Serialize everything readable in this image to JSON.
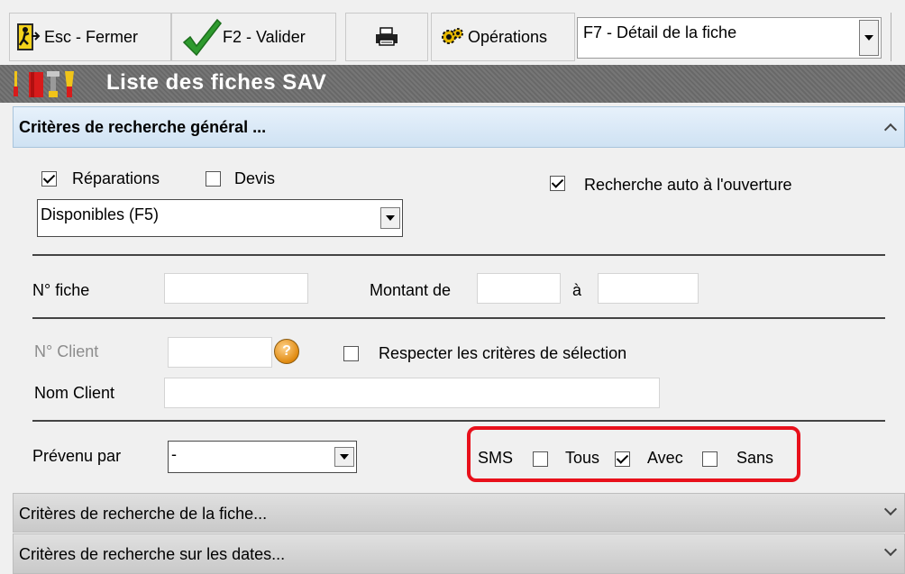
{
  "toolbar": {
    "close_label": "Esc - Fermer",
    "validate_label": "F2 - Valider",
    "operations_label": "Opérations",
    "operations_select_value": "F7 - Détail de la fiche"
  },
  "title": "Liste des fiches SAV",
  "general_panel": {
    "header": "Critères de recherche général ...",
    "repairs_label": "Réparations",
    "repairs_checked": true,
    "quotes_label": "Devis",
    "quotes_checked": false,
    "auto_search_label": "Recherche auto à l'ouverture",
    "auto_search_checked": true,
    "availability_value": "Disponibles (F5)",
    "ticket_no_label": "N° fiche",
    "ticket_no_value": "",
    "amount_from_label": "Montant de",
    "amount_from_value": "",
    "amount_to_label": "à",
    "amount_to_value": "",
    "client_no_label": "N° Client",
    "client_no_value": "",
    "respect_criteria_label": "Respecter les critères de sélection",
    "respect_criteria_checked": false,
    "client_name_label": "Nom Client",
    "client_name_value": "",
    "notified_by_label": "Prévenu par",
    "notified_by_value": "-",
    "sms": {
      "label": "SMS",
      "all_label": "Tous",
      "all_checked": false,
      "with_label": "Avec",
      "with_checked": true,
      "without_label": "Sans",
      "without_checked": false
    }
  },
  "collapsed_panels": [
    {
      "label": "Critères de recherche de la fiche..."
    },
    {
      "label": "Critères de recherche sur les dates..."
    }
  ],
  "colors": {
    "highlight": "#e8101b",
    "title_bar": "#6e6e6e",
    "active_panel": "#cfe2f3"
  },
  "icons": [
    "exit-icon",
    "checkmark-icon",
    "printer-icon",
    "operations-gear-icon",
    "tools-icon",
    "help-icon",
    "chevron-up-icon",
    "chevron-down-icon"
  ]
}
